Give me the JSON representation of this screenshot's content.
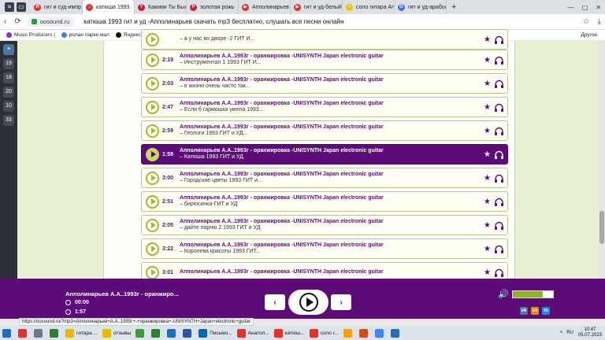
{
  "browser": {
    "tabs": [
      {
        "label": "гит и суд-импр",
        "color": "#e4322b",
        "glyph": "Я"
      },
      {
        "label": "катюша 1993",
        "color": "#e4322b",
        "glyph": "♪",
        "active": true
      },
      {
        "label": "Какими Ты Был",
        "color": "#c81e3a",
        "glyph": "Y"
      },
      {
        "label": "золотая рожь",
        "color": "#d21f2e",
        "glyph": "P"
      },
      {
        "label": "Апполинарьев",
        "color": "#e4322b",
        "glyph": "▶"
      },
      {
        "label": "гит и уд-белый",
        "color": "#e4322b",
        "glyph": "▶"
      },
      {
        "label": "соло гитара Ап",
        "color": "#f5c400",
        "glyph": "•"
      },
      {
        "label": "гит и уд-арабск",
        "color": "#3b7bd8",
        "glyph": "G"
      }
    ],
    "url": "oosound.ru",
    "page_title": "катюша 1993 гит и уд -Апполинарьев скачать mp3 бесплатно, слушать все песни онлайн",
    "bookmarks": [
      {
        "label": "Music Producers |",
        "color": "#9c2ad4"
      },
      {
        "label": "ролан парке мал",
        "color": "#3f7fd9"
      },
      {
        "label": "Яндекс",
        "color": "#111111"
      },
      {
        "label": "Яндекс",
        "color": "#111111"
      }
    ],
    "other_bookmarks": "Другое"
  },
  "left_panel": [
    "≡",
    "19",
    "18",
    "20",
    "10",
    "33"
  ],
  "playlist": [
    {
      "duration": "",
      "title": "",
      "subtitle": "– а у нас во дворе -2 ГИТ И..."
    },
    {
      "duration": "2:19",
      "title": "Апполинарьев А.А..1993г - оранжировка -UNISYNTH Japan electronic guitar",
      "subtitle": "– Инструментал 1 1993 ГИТ И..."
    },
    {
      "duration": "2:03",
      "title": "Апполинарьев А.А..1993г - оранжировка -UNISYNTH Japan electronic guitar",
      "subtitle": "– в жизни очень часто так..."
    },
    {
      "duration": "2:47",
      "title": "Апполинарьев А.А..1993г - оранжировка -UNISYNTH Japan electronic guitar",
      "subtitle": "– Если б гармошка умела 1993..."
    },
    {
      "duration": "2:59",
      "title": "Апполинарьев А.А..1993г - оранжировка -UNISYNTH Japan electronic guitar",
      "subtitle": "– Геологи 1993 ГИТ и УД..."
    },
    {
      "duration": "1:58",
      "title": "Апполинарьев А.А..1993г - оранжировка -UNISYNTH Japan electronic guitar",
      "subtitle": "– Катюша 1993 ГИТ и УД",
      "active": true
    },
    {
      "duration": "3:00",
      "title": "Апполинарьев А.А..1993г - оранжировка -UNISYNTH Japan electronic guitar",
      "subtitle": "– Городские цветы 1993 ГИТ и..."
    },
    {
      "duration": "2:51",
      "title": "Апполинарьев А.А..1993г - оранжировка -UNISYNTH Japan electronic guitar",
      "subtitle": "– бирюсинка-ГИТ и УД"
    },
    {
      "duration": "2:05",
      "title": "Апполинарьев А.А..1993г - оранжировка -UNISYNTH Japan electronic guitar",
      "subtitle": "– дайте парню 2 1993 ГИТ и УД"
    },
    {
      "duration": "3:22",
      "title": "Апполинарьев А.А..1993г - оранжировка -UNISYNTH Japan electronic guitar",
      "subtitle": "– Королева красоты 1993 ГИТ..."
    },
    {
      "duration": "3:01",
      "title": "Апполинарьев А.А..1993г - оранжировка -UNISYNTH Japan electronic guitar",
      "subtitle": ""
    }
  ],
  "player": {
    "now_playing": "Апполинарьев А.А..1993г - оранжиро...",
    "elapsed": "00:00",
    "total": "1:57",
    "volume_fraction": 0.75,
    "prev_icon": "‹",
    "next_icon": "›"
  },
  "social": [
    {
      "label": "vk",
      "color": "#4c75a3"
    },
    {
      "label": "ок",
      "color": "#ee8208"
    },
    {
      "label": "m",
      "color": "#168de2"
    }
  ],
  "status_url": "https://oosound.ru/?mp3=Апполинарьев+А.А..1993г+-+оранжировка+-UNISYNTH+Japan+electronic+guitar",
  "taskbar": {
    "items": [
      {
        "label": "",
        "color": "#e4322b"
      },
      {
        "label": "",
        "color": "#6b7b8c"
      },
      {
        "label": "",
        "color": "#2e7d32"
      },
      {
        "label": "гитара ...",
        "color": "#e8b900"
      },
      {
        "label": "отзывы",
        "color": "#e8b900"
      },
      {
        "label": "",
        "color": "#3d9a3d"
      },
      {
        "label": "",
        "color": "#2e7d32"
      },
      {
        "label": "",
        "color": "#1f6fc1"
      },
      {
        "label": "",
        "color": "#2b579a"
      },
      {
        "label": "Письмо...",
        "color": "#0a64ad"
      },
      {
        "label": "Анатол...",
        "color": "#e4322b"
      },
      {
        "label": "катюш...",
        "color": "#e4322b"
      },
      {
        "label": "соло г...",
        "color": "#e4322b"
      },
      {
        "label": "",
        "color": "#f0a30a"
      },
      {
        "label": "",
        "color": "#d04b1f"
      },
      {
        "label": "",
        "color": "#4285f4"
      },
      {
        "label": "",
        "color": "#2b6cb0"
      }
    ],
    "lang": "RU",
    "time": "10:47",
    "date": "05.07.2023"
  }
}
